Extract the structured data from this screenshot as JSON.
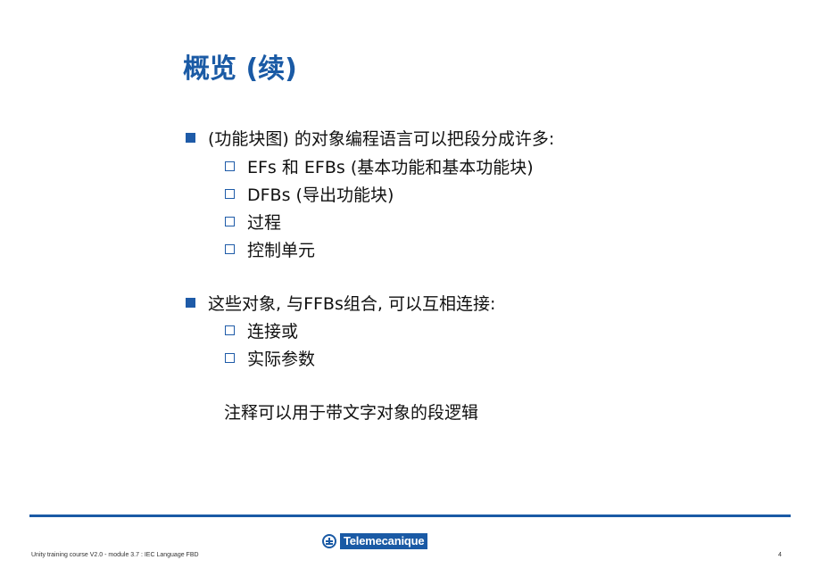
{
  "slide": {
    "title": "概览 (续)",
    "sections": [
      {
        "text": "(功能块图) 的对象编程语言可以把段分成许多:",
        "items": [
          "EFs 和 EFBs (基本功能和基本功能块)",
          "DFBs (导出功能块)",
          "过程",
          "控制单元"
        ]
      },
      {
        "text": "这些对象, 与FFBs组合, 可以互相连接:",
        "items": [
          "连接或",
          "实际参数"
        ]
      }
    ],
    "note": "注释可以用于带文字对象的段逻辑"
  },
  "footer": {
    "caption": "Unity training course V2.0 - module 3.7 : IEC Language FBD",
    "logo_text": "Telemecanique",
    "logo_icon": "telemecanique-logo-icon",
    "page_number": "4"
  },
  "colors": {
    "accent": "#1a5aa5",
    "text": "#111111"
  }
}
